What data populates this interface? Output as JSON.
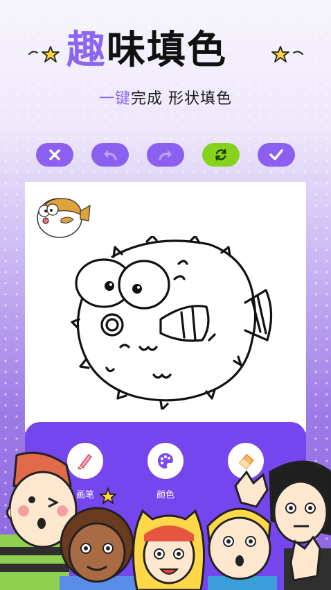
{
  "title": {
    "highlight": "趣",
    "rest": "味填色"
  },
  "subtitle": {
    "highlight": "一键",
    "rest": "完成 形状填色"
  },
  "toolbar": {
    "buttons": [
      {
        "name": "close",
        "icon": "close-icon"
      },
      {
        "name": "undo",
        "icon": "undo-icon"
      },
      {
        "name": "redo",
        "icon": "redo-icon"
      },
      {
        "name": "reset",
        "icon": "refresh-icon"
      },
      {
        "name": "confirm",
        "icon": "check-icon"
      }
    ]
  },
  "canvas": {
    "reference_icon": "colored-pufferfish-preview",
    "line_art": "pufferfish-outline"
  },
  "tools": [
    {
      "label": "画笔",
      "icon": "brush-icon"
    },
    {
      "label": "颜色",
      "icon": "palette-icon"
    },
    {
      "label": "",
      "icon": "eraser-icon"
    }
  ],
  "colors": {
    "accent": "#8c66f0",
    "toolbar_button": "#8b5ff0",
    "reset_button": "#86d21c",
    "panel": "#7545ee"
  }
}
